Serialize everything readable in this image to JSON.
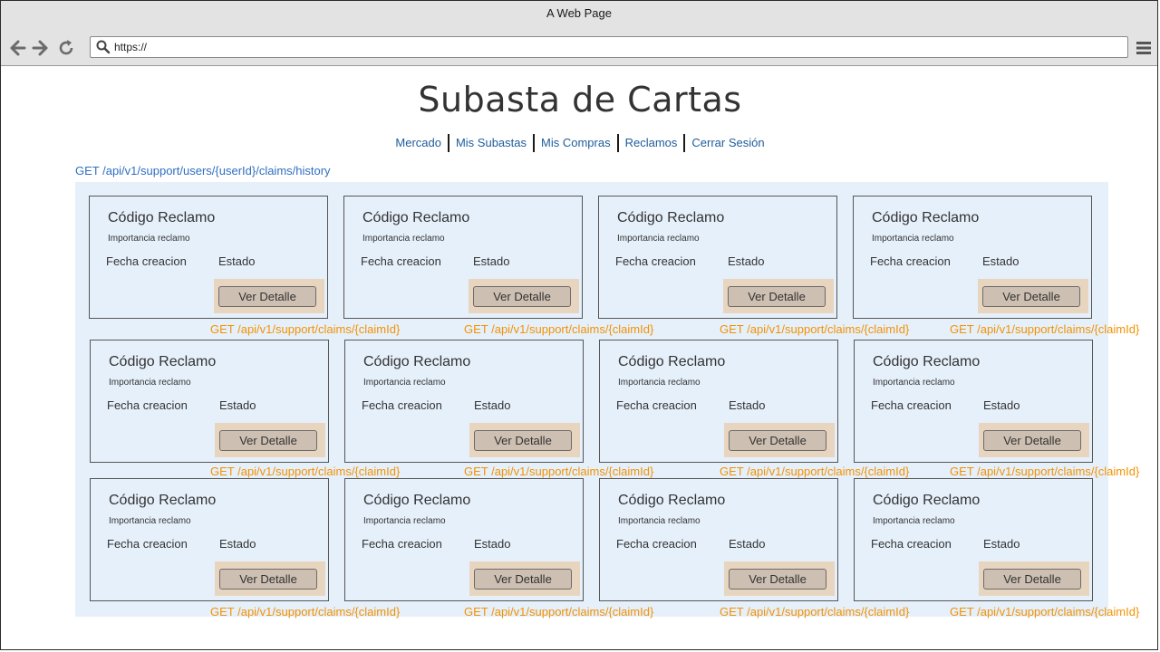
{
  "window": {
    "title": "A Web Page"
  },
  "browser": {
    "url": "https://"
  },
  "page": {
    "title": "Subasta de Cartas",
    "nav": [
      "Mercado",
      "Mis Subastas",
      "Mis Compras",
      "Reclamos",
      "Cerrar Sesión"
    ],
    "history_endpoint": "GET /api/v1/support/users/{userId}/claims/history"
  },
  "cards": [
    {
      "title": "Código Reclamo",
      "importance": "Importancia reclamo",
      "date": "Fecha creacion",
      "status": "Estado",
      "button": "Ver Detalle",
      "endpoint": "GET /api/v1/support/claims/{claimId}"
    },
    {
      "title": "Código Reclamo",
      "importance": "Importancia reclamo",
      "date": "Fecha creacion",
      "status": "Estado",
      "button": "Ver Detalle",
      "endpoint": "GET /api/v1/support/claims/{claimId}"
    },
    {
      "title": "Código Reclamo",
      "importance": "Importancia reclamo",
      "date": "Fecha creacion",
      "status": "Estado",
      "button": "Ver Detalle",
      "endpoint": "GET /api/v1/support/claims/{claimId}"
    },
    {
      "title": "Código Reclamo",
      "importance": "Importancia reclamo",
      "date": "Fecha creacion",
      "status": "Estado",
      "button": "Ver Detalle",
      "endpoint": "GET /api/v1/support/claims/{claimId}"
    },
    {
      "title": "Código Reclamo",
      "importance": "Importancia reclamo",
      "date": "Fecha creacion",
      "status": "Estado",
      "button": "Ver Detalle",
      "endpoint": "GET /api/v1/support/claims/{claimId}"
    },
    {
      "title": "Código Reclamo",
      "importance": "Importancia reclamo",
      "date": "Fecha creacion",
      "status": "Estado",
      "button": "Ver Detalle",
      "endpoint": "GET /api/v1/support/claims/{claimId}"
    },
    {
      "title": "Código Reclamo",
      "importance": "Importancia reclamo",
      "date": "Fecha creacion",
      "status": "Estado",
      "button": "Ver Detalle",
      "endpoint": "GET /api/v1/support/claims/{claimId}"
    },
    {
      "title": "Código Reclamo",
      "importance": "Importancia reclamo",
      "date": "Fecha creacion",
      "status": "Estado",
      "button": "Ver Detalle",
      "endpoint": "GET /api/v1/support/claims/{claimId}"
    },
    {
      "title": "Código Reclamo",
      "importance": "Importancia reclamo",
      "date": "Fecha creacion",
      "status": "Estado",
      "button": "Ver Detalle",
      "endpoint": "GET /api/v1/support/claims/{claimId}"
    },
    {
      "title": "Código Reclamo",
      "importance": "Importancia reclamo",
      "date": "Fecha creacion",
      "status": "Estado",
      "button": "Ver Detalle",
      "endpoint": "GET /api/v1/support/claims/{claimId}"
    },
    {
      "title": "Código Reclamo",
      "importance": "Importancia reclamo",
      "date": "Fecha creacion",
      "status": "Estado",
      "button": "Ver Detalle",
      "endpoint": "GET /api/v1/support/claims/{claimId}"
    },
    {
      "title": "Código Reclamo",
      "importance": "Importancia reclamo",
      "date": "Fecha creacion",
      "status": "Estado",
      "button": "Ver Detalle",
      "endpoint": "GET /api/v1/support/claims/{claimId}"
    }
  ],
  "icons": {
    "back": "arrow-left-icon",
    "forward": "arrow-right-icon",
    "reload": "reload-icon",
    "search": "search-icon",
    "menu": "hamburger-menu-icon"
  },
  "colors": {
    "nav_link": "#1e5d9c",
    "history_endpoint": "#2f6fc2",
    "detail_endpoint": "#f39200",
    "panel_bg": "#e6f0fb",
    "button_wrap_bg": "#e8d5c0"
  }
}
